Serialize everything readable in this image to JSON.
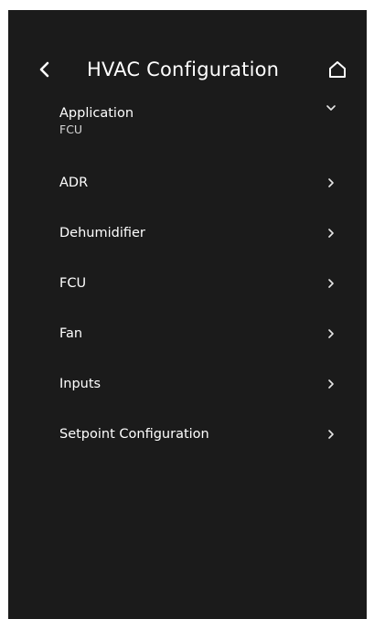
{
  "header": {
    "title": "HVAC Configuration",
    "back_icon": "chevron-left-icon",
    "home_icon": "home-icon"
  },
  "menu": {
    "items": [
      {
        "label": "Application",
        "value": "FCU",
        "icon": "chevron-down-icon"
      },
      {
        "label": "ADR",
        "icon": "chevron-right-icon"
      },
      {
        "label": "Dehumidifier",
        "icon": "chevron-right-icon"
      },
      {
        "label": "FCU",
        "icon": "chevron-right-icon"
      },
      {
        "label": "Fan",
        "icon": "chevron-right-icon"
      },
      {
        "label": "Inputs",
        "icon": "chevron-right-icon"
      },
      {
        "label": "Setpoint Configuration",
        "icon": "chevron-right-icon"
      }
    ]
  },
  "colors": {
    "background": "#1b1b1b",
    "text": "#ffffff",
    "icon": "#e6e6e6"
  }
}
